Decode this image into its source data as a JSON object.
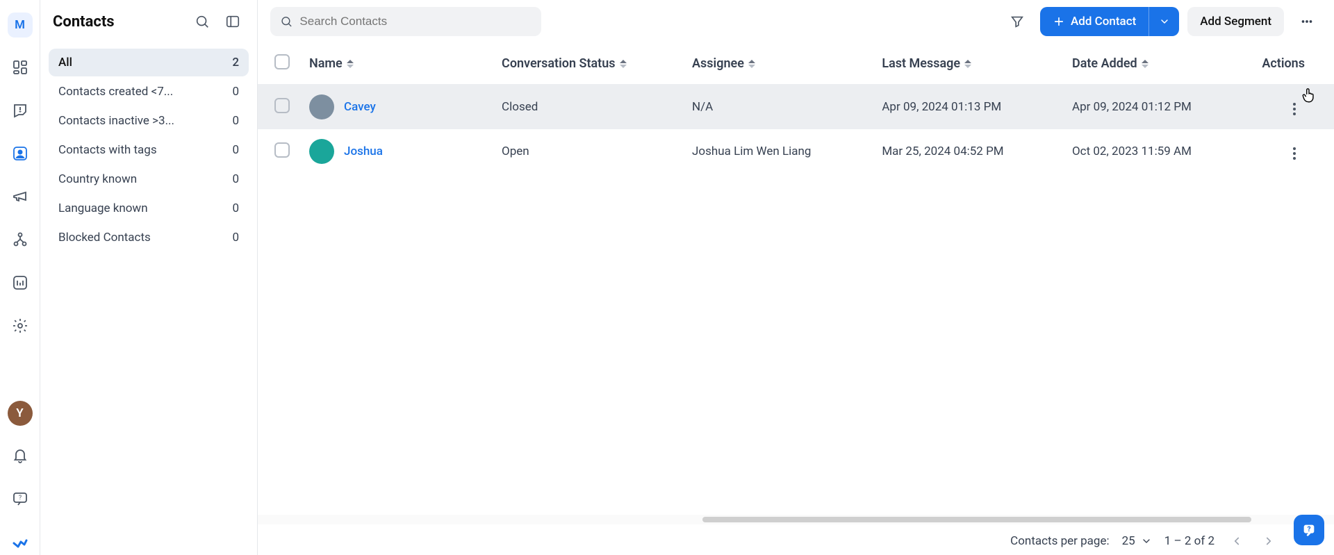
{
  "workspace_letter": "M",
  "user_letter": "Y",
  "rail": {
    "icons": [
      "dashboard",
      "inbox",
      "contacts",
      "broadcast",
      "workflow",
      "reports",
      "settings"
    ],
    "active": "contacts"
  },
  "sidebar": {
    "title": "Contacts",
    "filters": [
      {
        "label": "All",
        "count": 2,
        "active": true
      },
      {
        "label": "Contacts created <7...",
        "count": 0
      },
      {
        "label": "Contacts inactive >3...",
        "count": 0
      },
      {
        "label": "Contacts with tags",
        "count": 0
      },
      {
        "label": "Country known",
        "count": 0
      },
      {
        "label": "Language known",
        "count": 0
      },
      {
        "label": "Blocked Contacts",
        "count": 0
      }
    ]
  },
  "topbar": {
    "search_placeholder": "Search Contacts",
    "add_contact": "Add Contact",
    "add_segment": "Add Segment"
  },
  "table": {
    "columns": {
      "name": "Name",
      "status": "Conversation Status",
      "assignee": "Assignee",
      "last": "Last Message",
      "added": "Date Added",
      "actions": "Actions"
    },
    "rows": [
      {
        "name": "Cavey",
        "status": "Closed",
        "assignee": "N/A",
        "last": "Apr 09, 2024 01:13 PM",
        "added": "Apr 09, 2024 01:12 PM",
        "avatar": "grey",
        "hovered": true
      },
      {
        "name": "Joshua",
        "status": "Open",
        "assignee": "Joshua Lim Wen Liang",
        "last": "Mar 25, 2024 04:52 PM",
        "added": "Oct 02, 2023 11:59 AM",
        "avatar": "green"
      }
    ]
  },
  "footer": {
    "label": "Contacts per page:",
    "per_page": "25",
    "range": "1 – 2 of 2"
  }
}
